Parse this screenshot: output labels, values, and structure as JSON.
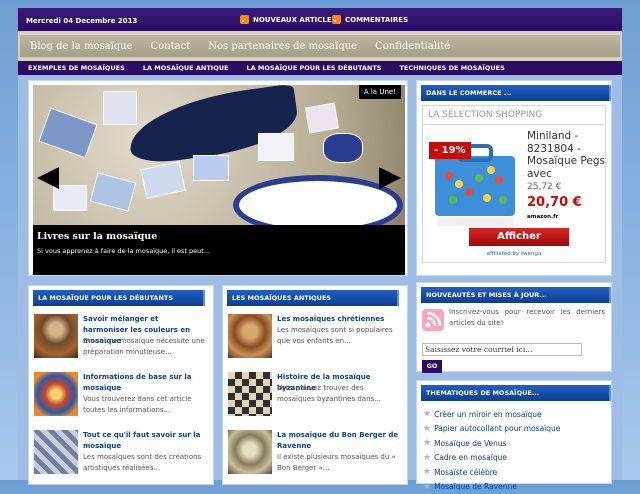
{
  "topbar": {
    "date": "Mercredi 04 Decembre 2013",
    "feed1": "NOUVEAUX ARTICLES",
    "feed2": "COMMENTAIRES"
  },
  "menu_main": [
    "Blog de la mosaïque",
    "Contact",
    "Nos partenaires de mosaïque",
    "Confidentialité"
  ],
  "menu_cats": [
    "EXEMPLES DE MOSAÏQUES",
    "LA MOSAÏQUE ANTIQUE",
    "LA MOSAÏQUE POUR LES DÉBUTANTS",
    "TECHNIQUES DE MOSAÏQUES"
  ],
  "slider": {
    "badge": "A la Une!",
    "title": "Livres sur la mosaïque",
    "text": "Si vous apprenez à faire de la mosaïque, il est peut..."
  },
  "col1": {
    "heading": "LA MOSAÏQUE POUR LES DÉBUTANTS",
    "items": [
      {
        "title": "Savoir mélanger et harmoniser les couleurs en mosaïque",
        "text": "Créer une mosaïque nécessite une préparation minutieuse..."
      },
      {
        "title": "Informations de base sur la mosaïque",
        "text": "Vous trouverez dans cet article toutes les informations..."
      },
      {
        "title": "Tout ce qu'il faut savoir sur la mosaïque",
        "text": "Les mosaïques sont des créations artistiques réalisées..."
      }
    ]
  },
  "col2": {
    "heading": "LES MOSAÏQUES ANTIQUES",
    "items": [
      {
        "title": "Les mosaïques chrétiennes",
        "text": "Les mosaïques sont si populaires que vos enfants en..."
      },
      {
        "title": "Histoire de la mosaïque byzantine",
        "text": "Vous pouvez trouver des mosaïques byzantines dans..."
      },
      {
        "title": "La mosaïque du Bon Berger de Ravenne",
        "text": "Il existe plusieurs mosaïques du « Bon Berger »..."
      }
    ]
  },
  "shop": {
    "heading": "DANS LE COMMERCE ...",
    "label": "LA SÉLECTION SHOPPING",
    "discount": "- 19%",
    "product": "Miniland - 8231804 - Mosaïque Pegs avec",
    "old_price": "25,72 €",
    "price": "20,70 €",
    "seller": "amazon.fr",
    "button": "Afficher",
    "affiliate": "affiliated by twenga"
  },
  "newsletter": {
    "heading": "NOUVEAUTÉS ET MISES À JOUR...",
    "text": "Inscrivez-vous pour recevoir les derniers articles du site!",
    "placeholder": "Saisissez votre courriel ici...",
    "button": "GO"
  },
  "themes": {
    "heading": "THEMATIQUES DE MOSAÏQUE...",
    "items": [
      "Créer un miroir en mosaïque",
      "Papier autocollant pour mosaïque",
      "Mosaïque de Venus",
      "Cadre en mosaïque",
      "Mosaïste célèbre",
      "Mosaïque de Ravenne"
    ]
  }
}
